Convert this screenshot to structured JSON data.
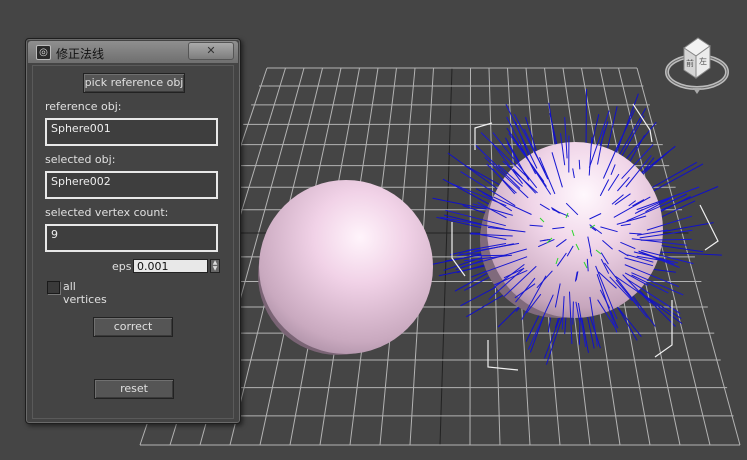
{
  "dialog": {
    "title": "修正法线",
    "pick_button": "pick reference obj",
    "reference_label": "reference obj:",
    "reference_value": "Sphere001",
    "selected_label": "selected obj:",
    "selected_value": "Sphere002",
    "count_label": "selected vertex count:",
    "count_value": "9",
    "eps_label": "eps",
    "eps_value": "0.001",
    "all_vertices_label": "all vertices",
    "all_vertices_checked": false,
    "correct_button": "correct",
    "reset_button": "reset"
  },
  "viewport": {
    "nav_cube_front": "前",
    "nav_cube_left": "左"
  },
  "colors": {
    "viewport_bg": "#454545",
    "grid": "#b5b5b5",
    "sphere": "#e6c8de",
    "normals": "#0a0ad8",
    "selected_vertices": "#2bd62b"
  },
  "icons": {
    "app": "3ds-max-icon",
    "close": "close-x-icon",
    "spinner": "spinner-arrows-icon"
  }
}
